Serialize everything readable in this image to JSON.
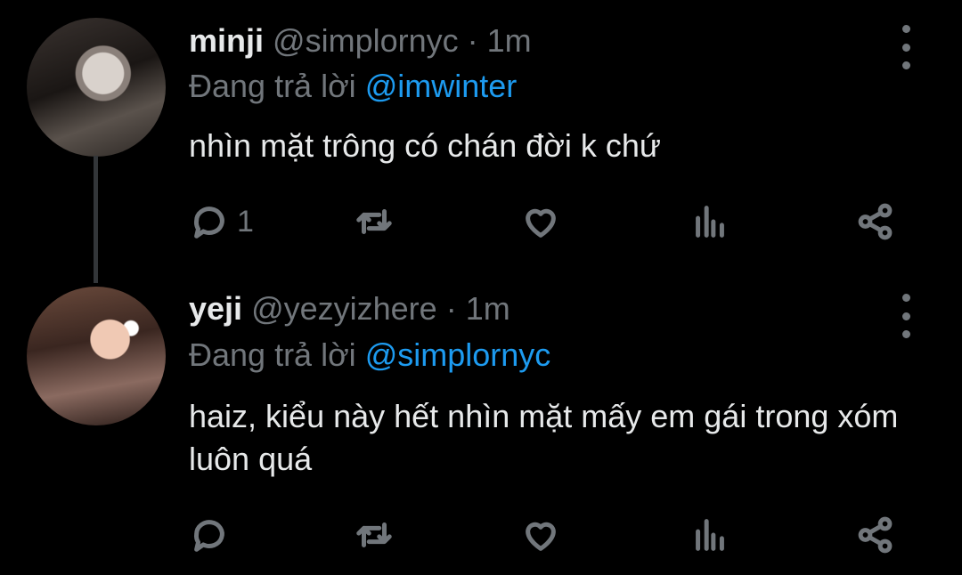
{
  "tweets": [
    {
      "name": "minji",
      "handle": "@simplornyc",
      "time": "· 1m",
      "replying_prefix": "Đang trả lời",
      "replying_to": "@imwinter",
      "text": "nhìn mặt trông có chán đời k chứ",
      "reply_count": "1"
    },
    {
      "name": "yeji",
      "handle": "@yezyizhere",
      "time": "· 1m",
      "replying_prefix": "Đang trả lời",
      "replying_to": "@simplornyc",
      "text": "haiz, kiểu này hết nhìn mặt mấy em gái trong xóm luôn quá",
      "reply_count": ""
    }
  ],
  "icons": [
    "reply-icon",
    "retweet-icon",
    "like-icon",
    "analytics-icon",
    "share-icon",
    "more-icon"
  ],
  "colors": {
    "background": "#000000",
    "text": "#e7e9ea",
    "muted": "#71767b",
    "link": "#1d9bf0"
  }
}
